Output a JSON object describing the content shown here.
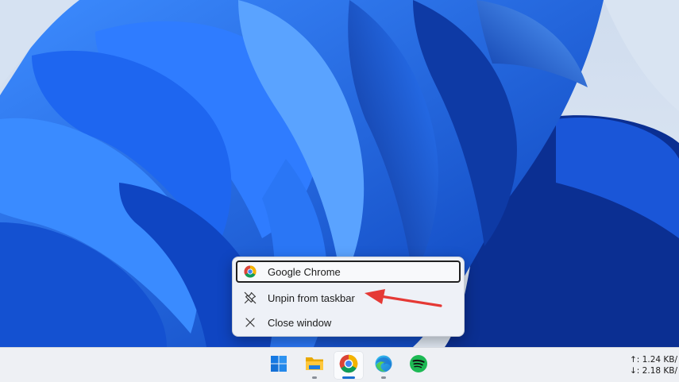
{
  "jump_list": {
    "items": [
      {
        "label": "Google Chrome",
        "icon": "chrome-icon"
      },
      {
        "label": "Unpin from taskbar",
        "icon": "unpin-icon"
      },
      {
        "label": "Close window",
        "icon": "close-icon"
      }
    ]
  },
  "annotation": {
    "color": "#e53935",
    "icon": "red-arrow-icon"
  },
  "taskbar": {
    "apps": [
      {
        "name": "Start",
        "icon": "windows-start-icon"
      },
      {
        "name": "File Explorer",
        "icon": "file-explorer-icon"
      },
      {
        "name": "Google Chrome",
        "icon": "chrome-icon",
        "active": true
      },
      {
        "name": "Microsoft Edge",
        "icon": "edge-icon"
      },
      {
        "name": "Spotify",
        "icon": "spotify-icon"
      }
    ],
    "network": {
      "upload": "↑: 1.24 KB/",
      "download": "↓: 2.18 KB/"
    }
  },
  "colors": {
    "accent": "#1a6fd1",
    "wallpaper_base": "#1556d6",
    "arrow": "#e53935"
  }
}
